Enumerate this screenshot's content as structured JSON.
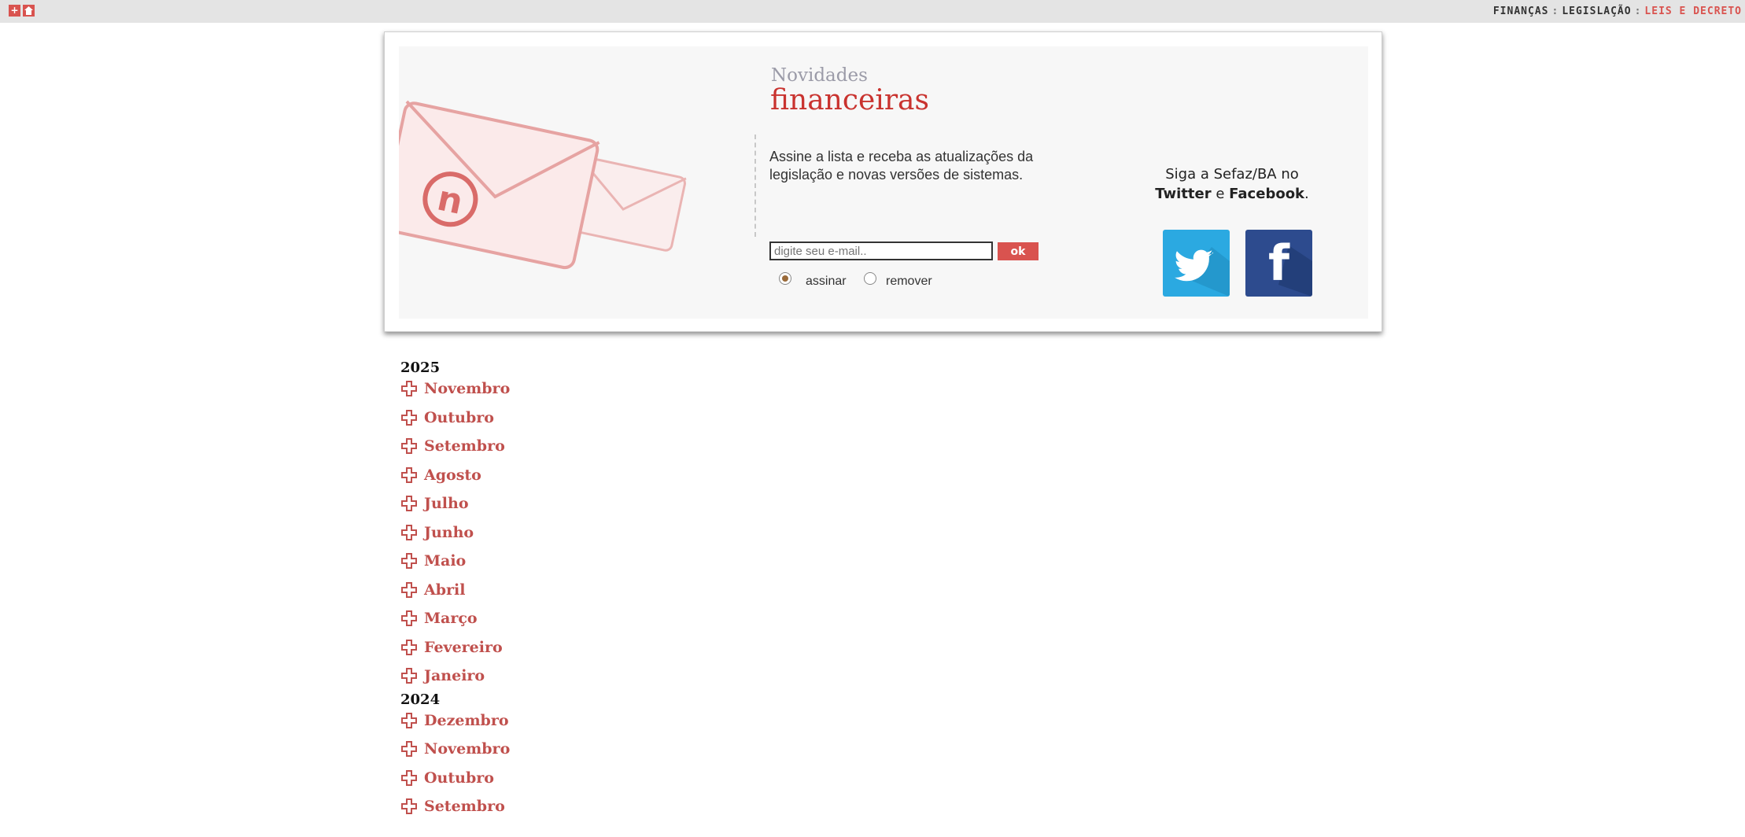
{
  "topbar": {
    "breadcrumb": [
      {
        "label": "FINANÇAS",
        "active": false
      },
      {
        "label": "LEGISLAÇÃO",
        "active": false
      },
      {
        "label": "LEIS E DECRETO",
        "active": true
      }
    ],
    "separator": ":"
  },
  "newsletter": {
    "title_small": "Novidades",
    "title_big": "financeiras",
    "description": "Assine a lista e receba as atualizações da legislação e novas versões de sistemas.",
    "email_placeholder": "digite seu e-mail..",
    "submit_label": "ok",
    "options": [
      {
        "label": "assinar",
        "checked": true
      },
      {
        "label": "remover",
        "checked": false
      }
    ]
  },
  "social": {
    "follow_line1": "Siga a Sefaz/BA no",
    "twitter": "Twitter",
    "and": "e",
    "facebook": "Facebook",
    "period": ".",
    "facebook_glyph": "f"
  },
  "archive": [
    {
      "year": "2025",
      "months": [
        "Novembro",
        "Outubro",
        "Setembro",
        "Agosto",
        "Julho",
        "Junho",
        "Maio",
        "Abril",
        "Março",
        "Fevereiro",
        "Janeiro"
      ]
    },
    {
      "year": "2024",
      "months": [
        "Dezembro",
        "Novembro",
        "Outubro",
        "Setembro"
      ]
    }
  ],
  "colors": {
    "accent": "#c0504d",
    "button_red": "#d9534f",
    "twitter": "#2ba9e1",
    "facebook": "#2d4b8e"
  }
}
